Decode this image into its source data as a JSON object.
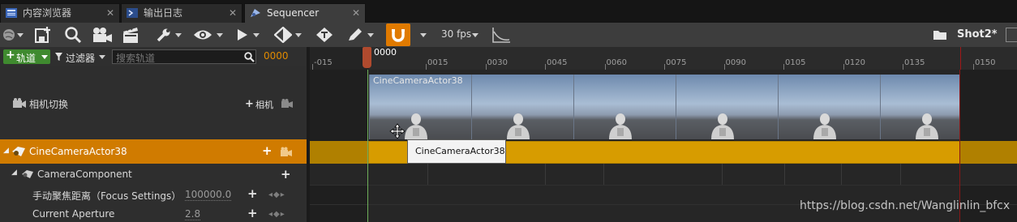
{
  "tabs": [
    {
      "label": "内容浏览器",
      "close": "✕",
      "state": "inactive"
    },
    {
      "label": "输出日志",
      "close": "✕",
      "state": "inactive"
    },
    {
      "label": "Sequencer",
      "close": "✕",
      "state": "active"
    }
  ],
  "toolbar": {
    "fps_label": "30 fps",
    "shot_label": "Shot2*",
    "icons": [
      "world-icon",
      "save-icon",
      "search-icon",
      "camera-icon",
      "clapper-icon",
      "wrench-icon",
      "eye-icon",
      "play-icon",
      "key-icon",
      "tag-key-icon",
      "pencil-icon",
      "magnet-icon",
      "curve-icon",
      "folder-icon"
    ]
  },
  "filter_bar": {
    "add_track_label": "轨道",
    "filter_label": "过滤器",
    "search_placeholder": "搜索轨道",
    "current_frame": "0000"
  },
  "ruler": {
    "playhead_label": "0000",
    "ticks": [
      "-015",
      "0015",
      "0030",
      "0045",
      "0060",
      "0075",
      "0090",
      "0105",
      "0120",
      "0135",
      "0150"
    ]
  },
  "tracks": {
    "camera_cut": {
      "label": "相机切换",
      "add_label": "相机"
    },
    "actor": {
      "label": "CineCameraActor38"
    },
    "component": {
      "label": "CameraComponent"
    },
    "properties": [
      {
        "label": "手动聚焦距离（Focus Settings）",
        "value": "100000.0",
        "key_controls": "◂◆▸"
      },
      {
        "label": "Current Aperture",
        "value": "2.8",
        "key_controls": "◂◆▸"
      }
    ]
  },
  "timeline": {
    "camera_section_label": "CineCameraActor38",
    "tooltip": "CineCameraActor38",
    "watermark": "https://blog.csdn.net/Wanglinlin_bfcx"
  },
  "colors": {
    "accent": "#e08a00",
    "track_bar": "#d79c00",
    "magnet": "#e07a00",
    "add_green": "#3f8a2f"
  }
}
